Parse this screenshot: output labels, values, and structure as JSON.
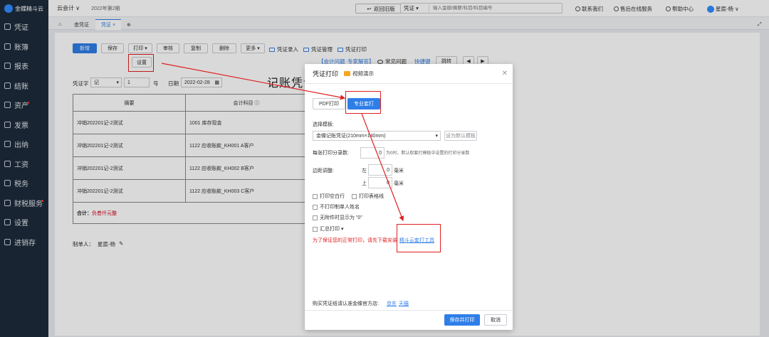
{
  "sidebar": {
    "brand": "金蝶精斗云",
    "items": [
      {
        "label": "凭证",
        "icon": "voucher-icon",
        "dot": false
      },
      {
        "label": "账簿",
        "icon": "ledger-icon",
        "dot": false
      },
      {
        "label": "报表",
        "icon": "report-icon",
        "dot": false
      },
      {
        "label": "结账",
        "icon": "close-account-icon",
        "dot": false
      },
      {
        "label": "资产",
        "icon": "asset-icon",
        "dot": true
      },
      {
        "label": "发票",
        "icon": "invoice-icon",
        "dot": false
      },
      {
        "label": "出纳",
        "icon": "cashier-icon",
        "dot": false
      },
      {
        "label": "工资",
        "icon": "salary-icon",
        "dot": false
      },
      {
        "label": "税务",
        "icon": "tax-icon",
        "dot": false
      },
      {
        "label": "财税服务",
        "icon": "tax-service-icon",
        "dot": true
      },
      {
        "label": "设置",
        "icon": "gear-icon",
        "dot": false
      },
      {
        "label": "进销存",
        "icon": "inventory-icon",
        "dot": false
      }
    ]
  },
  "topbar": {
    "app": "云会计 ∨",
    "period": "2022年第2期",
    "old_version": "返回旧版",
    "search_type": "凭证 ▾",
    "search_placeholder": "输入金额/摘要/科目/科目编号",
    "contact": "联系我们",
    "after_sale": "售后在线服务",
    "help": "帮助中心",
    "user": "星宸-杨 ∨"
  },
  "tabs": [
    "查凭证",
    "凭证 ×"
  ],
  "toolbar": {
    "new": "新增",
    "save": "保存",
    "print": "打印 ▾",
    "audit": "审核",
    "copy": "复制",
    "delete": "删除",
    "more": "更多 ▾",
    "voucher_entry": "凭证录入",
    "voucher_manage": "凭证管理",
    "voucher_print": "凭证打印",
    "settings": "设置",
    "accounting_q": "【会计问题",
    "expert": "专家解答】",
    "faq": "常见问题",
    "shortcut": "快捷键",
    "jump": "跳转",
    "prev": "◀",
    "next": "▶"
  },
  "voucher": {
    "title": "记账凭证",
    "word_label": "凭证字",
    "word": "记",
    "number": "1",
    "num_label": "号",
    "date_label": "日期",
    "date": "2022-02-28",
    "headers": [
      "摘要",
      "会计科目 ⓘ"
    ],
    "rows": [
      {
        "summary": "冲销202201记-2测试",
        "account": "1001 库存现金"
      },
      {
        "summary": "冲销202201记-2测试",
        "account": "1122 应收账款_KH001 A客户"
      },
      {
        "summary": "冲销202201记-2测试",
        "account": "1122 应收账款_KH002 B客户"
      },
      {
        "summary": "冲销202201记-2测试",
        "account": "1122 应收账款_KH003 C客户"
      }
    ],
    "total_label": "合计：",
    "total_value": "负叁仟元整",
    "maker_label": "制单人：",
    "maker": "星宸-杨"
  },
  "dialog": {
    "title": "凭证打印",
    "video": "视频演示",
    "tab_pdf": "PDF打印",
    "tab_pro": "专业套打",
    "template_label": "选择模板:",
    "template_value": "金蝶记账凭证(210mm×140mm)",
    "set_default": "设为默认模板",
    "copies_label": "每张打印分录数:",
    "copies_value": "0",
    "copies_hint": "为0时，默认取套打模板中设置的打印分录数",
    "margin_label": "边距调整:",
    "left_label": "左",
    "left_value": "0",
    "mm1": "毫米",
    "top_label": "上",
    "top_value": "0",
    "mm2": "毫米",
    "opt_empty_rows": "打印空白行",
    "opt_table_lines": "打印表格线",
    "opt_no_maker": "不打印制单人姓名",
    "opt_no_attach": "无附件时显示为 \"0\"",
    "opt_summary": "汇总打印 ▾",
    "warning": "为了保证您的正常打印，请先下载安装",
    "tool_link": "精斗云套打工具",
    "buy_label": "购买凭证纸请认准金蝶官方店:",
    "jd": "京东",
    "tmall": "天猫",
    "save_print": "保存并打印",
    "cancel": "取消"
  }
}
